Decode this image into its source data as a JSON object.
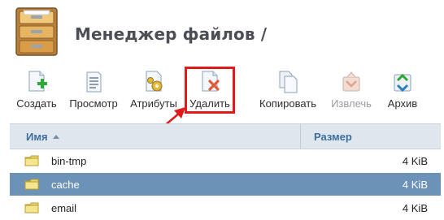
{
  "header": {
    "title": "Менеджер файлов /"
  },
  "toolbar": {
    "items": [
      {
        "label": "Создать",
        "icon": "new-file-icon",
        "enabled": true
      },
      {
        "label": "Просмотр",
        "icon": "view-icon",
        "enabled": true
      },
      {
        "label": "Атрибуты",
        "icon": "attributes-icon",
        "enabled": true
      },
      {
        "label": "Удалить",
        "icon": "delete-icon",
        "enabled": true,
        "highlighted": true
      },
      {
        "label": "Копировать",
        "icon": "copy-icon",
        "enabled": true
      },
      {
        "label": "Извлечь",
        "icon": "extract-icon",
        "enabled": false
      },
      {
        "label": "Архив",
        "icon": "archive-icon",
        "enabled": true
      }
    ]
  },
  "table": {
    "columns": {
      "name": "Имя",
      "size": "Размер"
    },
    "sort": {
      "column": "name",
      "direction": "asc"
    },
    "rows": [
      {
        "name": "bin-tmp",
        "size": "4 KiB",
        "selected": false
      },
      {
        "name": "cache",
        "size": "4 KiB",
        "selected": true
      },
      {
        "name": "email",
        "size": "4 KiB",
        "selected": false
      }
    ]
  },
  "colors": {
    "selection": "#6d92b7",
    "header_bg": "#dfe6ee",
    "header_text": "#3d6d9e",
    "highlight": "#e01a1a"
  }
}
